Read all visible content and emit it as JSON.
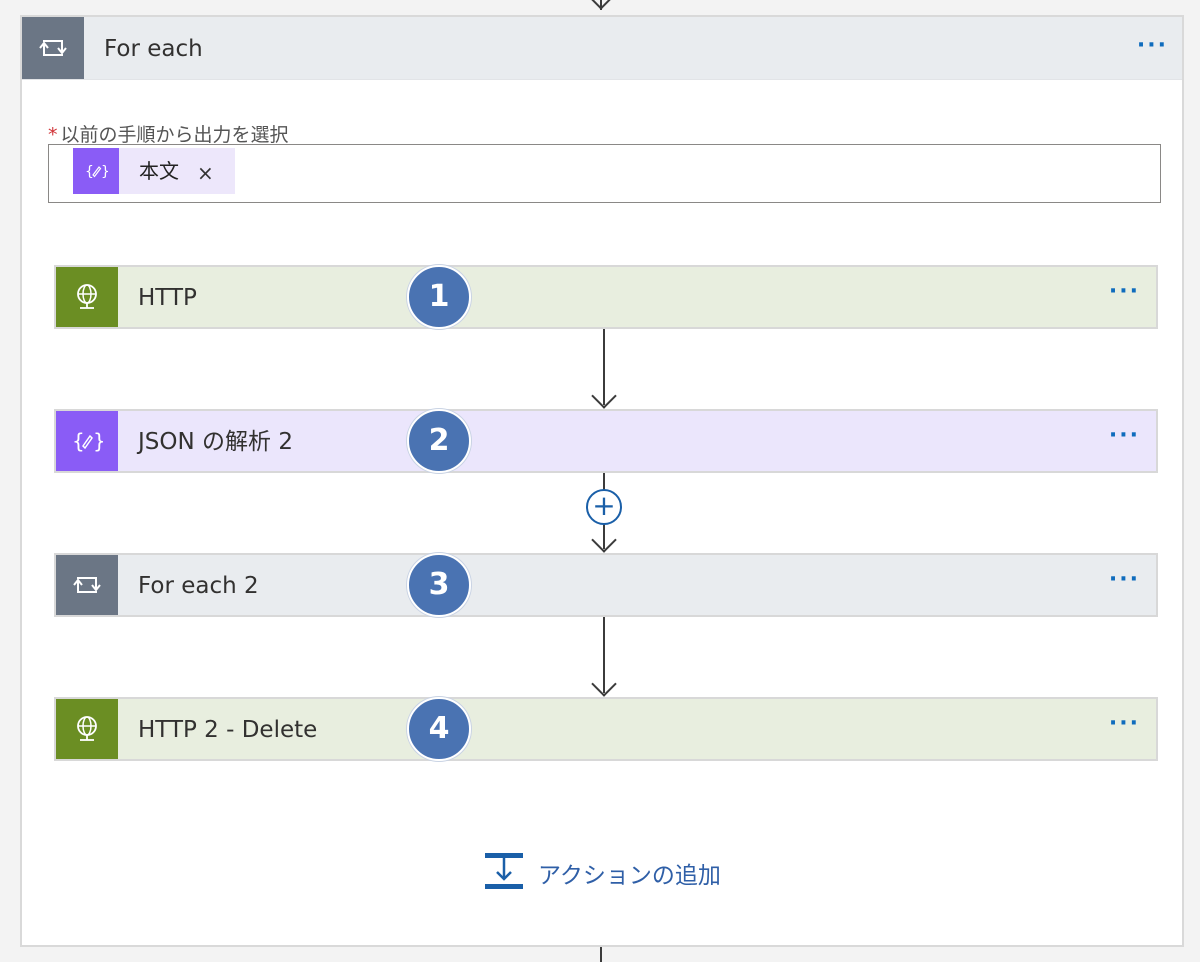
{
  "container": {
    "title": "For each",
    "more": "···",
    "field": {
      "required_mark": "*",
      "label": "以前の手順から出力を選択",
      "token": {
        "label": "本文",
        "remove": "×"
      }
    }
  },
  "actions": [
    {
      "title": "HTTP",
      "badge": "1",
      "more": "···",
      "kind": "http"
    },
    {
      "title": "JSON の解析 2",
      "badge": "2",
      "more": "···",
      "kind": "json"
    },
    {
      "title": "For each 2",
      "badge": "3",
      "more": "···",
      "kind": "loop"
    },
    {
      "title": "HTTP 2 - Delete",
      "badge": "4",
      "more": "···",
      "kind": "http"
    }
  ],
  "insert_step": "+",
  "add_action": {
    "label": "アクションの追加"
  },
  "colors": {
    "http_accent": "#6b8e23",
    "json_accent": "#8a5cf6",
    "loop_accent": "#6b7685",
    "badge": "#4a73b2",
    "link": "#2f5fa7"
  },
  "icons": {
    "loop": "loop-icon",
    "http": "globe-icon",
    "json": "data-operation-icon",
    "add_action": "add-action-icon"
  }
}
